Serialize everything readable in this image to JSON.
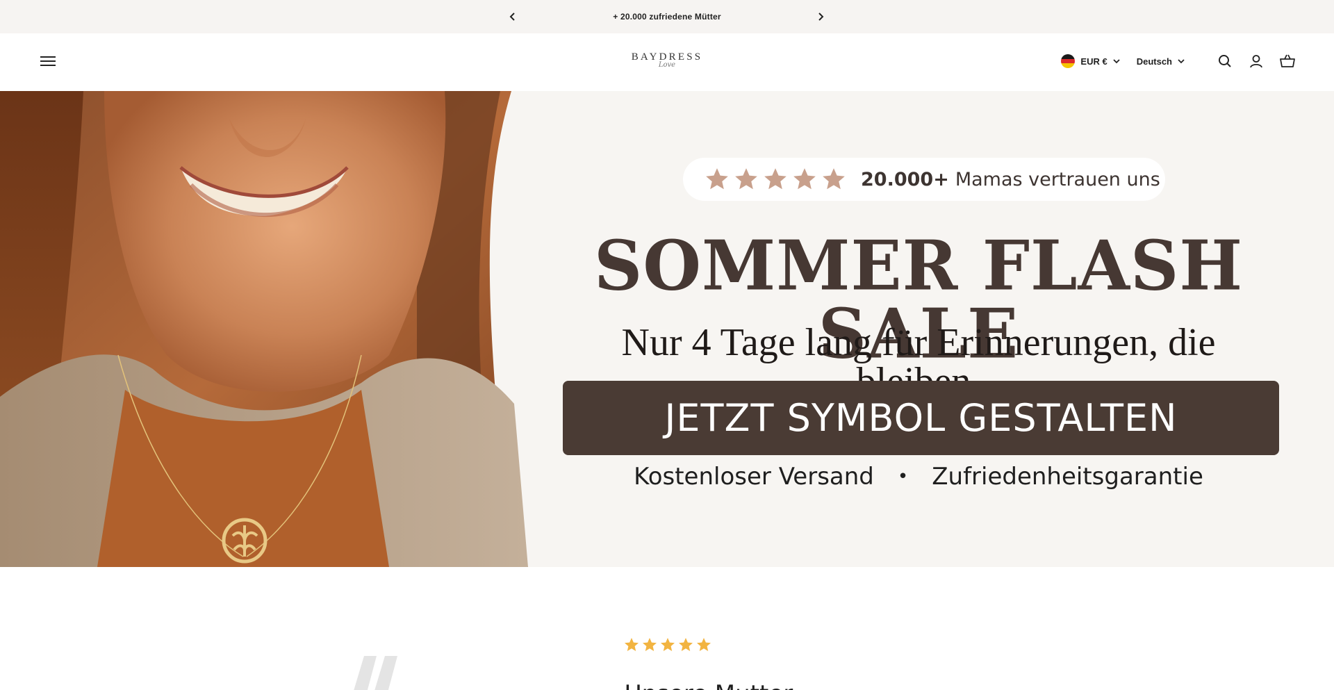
{
  "announcement": {
    "text": "+ 20.000 zufriedene Mütter",
    "prev_icon": "chevron-left-icon",
    "next_icon": "chevron-right-icon"
  },
  "header": {
    "logo_brand": "BAYDRESS",
    "logo_script": "Love",
    "currency": "EUR €",
    "language": "Deutsch",
    "icons": [
      "menu-icon",
      "flag-de-icon",
      "search-icon",
      "account-icon",
      "cart-icon"
    ]
  },
  "hero": {
    "rating_count": "20.000+",
    "rating_text": "Mamas vertrauen uns",
    "rating_stars": 5,
    "title": "SOMMER FLASH SALE",
    "subtitle": "Nur 4 Tage lang für Erinnerungen, die bleiben.",
    "cta_label": "JETZT SYMBOL GESTALTEN",
    "perks": [
      "Kostenloser Versand",
      "Zufriedenheitsgarantie"
    ],
    "perk_separator": "•"
  },
  "review": {
    "stars": 5,
    "text": "Unsere Mutter"
  },
  "colors": {
    "announce_bg": "#f6f4f2",
    "hero_bg": "#f7f5f2",
    "title": "#463833",
    "cta_bg": "#4a3b34",
    "star_hero": "#c8a08c",
    "star_review": "#f2b441"
  }
}
